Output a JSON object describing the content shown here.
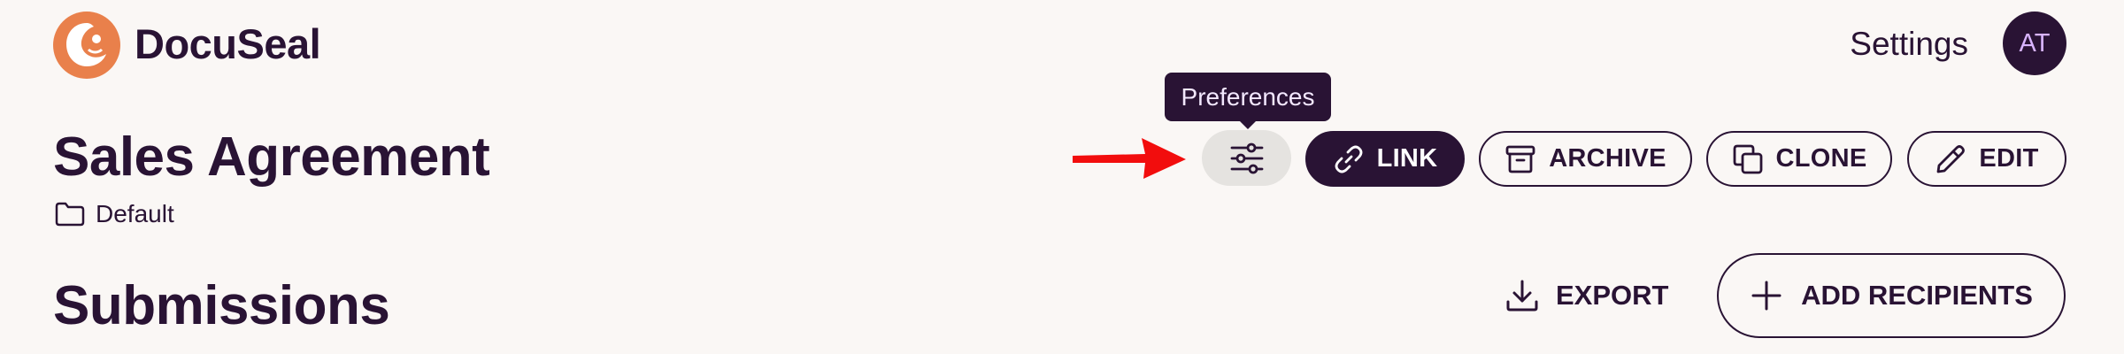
{
  "brand": {
    "name": "DocuSeal",
    "logo_icon": "docuseal-logo-icon",
    "logo_color": "#E9804B"
  },
  "header": {
    "settings_label": "Settings",
    "avatar_initials": "AT"
  },
  "template": {
    "title": "Sales Agreement",
    "folder": "Default"
  },
  "tooltip": {
    "text": "Preferences"
  },
  "toolbar": {
    "preferences_icon": "sliders-icon",
    "link_label": "LINK",
    "archive_label": "ARCHIVE",
    "clone_label": "CLONE",
    "edit_label": "EDIT"
  },
  "submissions": {
    "title": "Submissions",
    "export_label": "EXPORT",
    "add_recipients_label": "ADD RECIPIENTS"
  },
  "colors": {
    "background": "#FAF7F5",
    "primary": "#291334",
    "annotation_arrow": "#F20D0D"
  }
}
